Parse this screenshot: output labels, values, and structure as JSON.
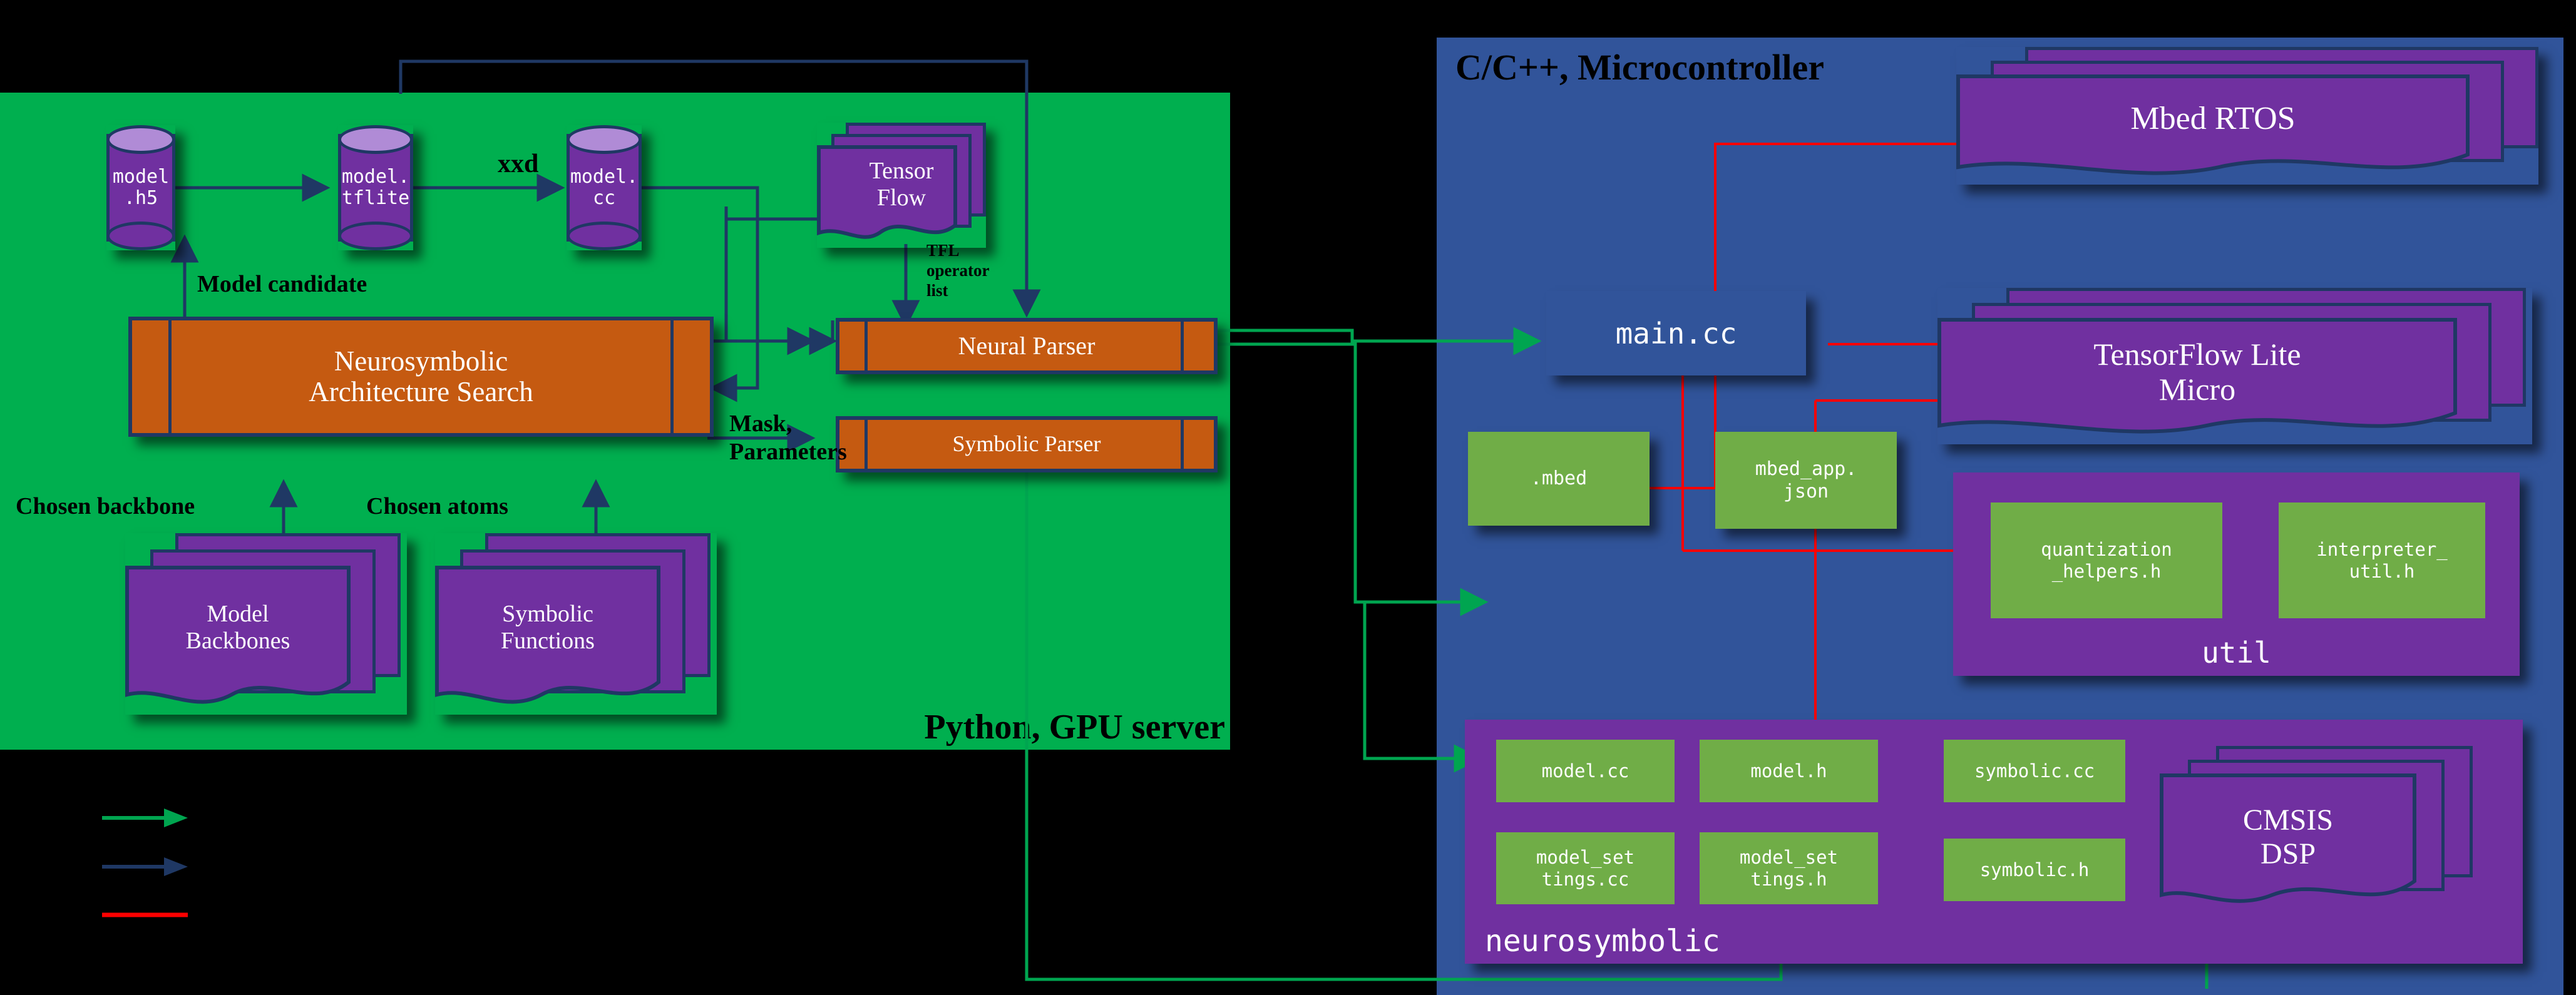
{
  "colors": {
    "python_panel_bg": "#00AF4F",
    "mcu_panel_bg": "#31549A",
    "process_box": "#C55A11",
    "artifact_purple": "#7030A0",
    "cylinder_top": "#B08BD6",
    "file_green": "#70AD47",
    "outline_navy": "#1F3864",
    "arrow_green": "#00A550",
    "arrow_navy": "#1F3864",
    "line_red": "#FF0000",
    "page_bg": "#000000"
  },
  "python_panel": {
    "label": "Python, GPU server",
    "artifacts": [
      {
        "name": "model-h5",
        "lines": [
          "model",
          ".h5"
        ]
      },
      {
        "name": "model-tflite",
        "lines": [
          "model.",
          "tflite"
        ]
      },
      {
        "name": "model-cc",
        "lines": [
          "model.",
          "cc"
        ]
      }
    ],
    "tensorflow_stack": {
      "lines": [
        "Tensor",
        "Flow"
      ]
    },
    "nas_box": {
      "lines": [
        "Neurosymbolic",
        "Architecture Search"
      ]
    },
    "parsers": [
      {
        "name": "neural-parser",
        "label": "Neural Parser"
      },
      {
        "name": "symbolic-parser",
        "label": "Symbolic Parser"
      }
    ],
    "libraries": [
      {
        "name": "model-backbones",
        "lines": [
          "Model",
          "Backbones"
        ]
      },
      {
        "name": "symbolic-functions",
        "lines": [
          "Symbolic",
          "Functions"
        ]
      }
    ],
    "edge_labels": {
      "xxd": "xxd",
      "model_candidate": "Model candidate",
      "tfl_operator_list": "TFL\noperator\nlist",
      "chosen_backbone": "Chosen backbone",
      "chosen_atoms": "Chosen atoms",
      "mask_parameters": "Mask,\nParameters"
    }
  },
  "mcu_panel": {
    "label": "C/C++, Microcontroller",
    "main_file": "main.cc",
    "config_files": [
      {
        "name": "mbed-config",
        "lines": [
          ".mbed"
        ]
      },
      {
        "name": "mbed-app-json",
        "lines": [
          "mbed_app.",
          "json"
        ]
      }
    ],
    "stacks": [
      {
        "name": "mbed-rtos",
        "lines": [
          "Mbed RTOS"
        ]
      },
      {
        "name": "tflite-micro",
        "lines": [
          "TensorFlow  Lite",
          "Micro"
        ]
      },
      {
        "name": "cmsis-dsp",
        "lines": [
          "CMSIS",
          "DSP"
        ]
      }
    ],
    "util_group": {
      "title": "util",
      "files": [
        {
          "name": "quantization-helpers-h",
          "lines": [
            "quantization",
            "_helpers.h"
          ]
        },
        {
          "name": "interpreter-util-h",
          "lines": [
            "interpreter_",
            "util.h"
          ]
        }
      ]
    },
    "neurosymbolic_group": {
      "title": "neurosymbolic",
      "files": [
        {
          "name": "model-cc",
          "lines": [
            "model.cc"
          ]
        },
        {
          "name": "model-h",
          "lines": [
            "model.h"
          ]
        },
        {
          "name": "symbolic-cc",
          "lines": [
            "symbolic.cc"
          ]
        },
        {
          "name": "model-settings-cc",
          "lines": [
            "model_set",
            "tings.cc"
          ]
        },
        {
          "name": "model-settings-h",
          "lines": [
            "model_set",
            "tings.h"
          ]
        },
        {
          "name": "symbolic-h",
          "lines": [
            "symbolic.h"
          ]
        }
      ]
    }
  },
  "legend": {
    "items": [
      {
        "name": "legend-green-arrow",
        "color": "#00A550",
        "arrow": true,
        "label": ""
      },
      {
        "name": "legend-navy-arrow",
        "color": "#1F3864",
        "arrow": true,
        "label": ""
      },
      {
        "name": "legend-red-line",
        "color": "#FF0000",
        "arrow": false,
        "label": ""
      }
    ]
  }
}
